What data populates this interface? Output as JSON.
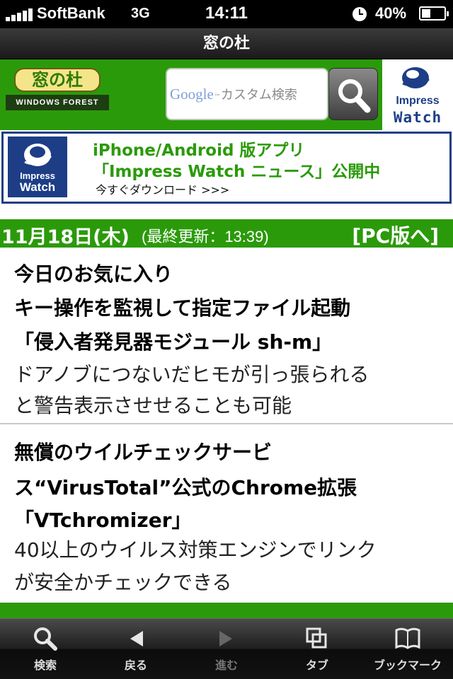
{
  "status_bar": {
    "carrier": "SoftBank",
    "network": "3G",
    "time": "14:11",
    "battery_percent": "40%",
    "battery_level": 0.4
  },
  "title_bar": {
    "title": "窓の杜"
  },
  "header": {
    "logo": {
      "name": "窓の杜",
      "subtitle": "WINDOWS FOREST"
    },
    "search": {
      "google_label": "Google",
      "placeholder": "カスタム検索",
      "button_icon": "search-icon"
    },
    "impress_watch": {
      "line1": "Impress",
      "line2": "Watch"
    }
  },
  "banner": {
    "logo_line1": "Impress",
    "logo_line2": "Watch",
    "line1": "iPhone/Android 版アプリ",
    "line2": "「Impress Watch ニュース」公開中",
    "line3": "今すぐダウンロード >>>"
  },
  "date_bar": {
    "date": "11月18日(木)",
    "updated": "(最終更新：13:39)",
    "pc_link": "[PC版へ]"
  },
  "articles": [
    {
      "title_lines": [
        "今日のお気に入り",
        "キー操作を監視して指定ファイル起動",
        "「侵入者発見器モジュール sh-m」"
      ],
      "desc_lines": [
        "ドアノブにつないだヒモが引っ張られる",
        "と警告表示させせることも可能"
      ]
    },
    {
      "title_lines": [
        "無償のウイルチェックサービ",
        "ス“VirusTotal”公式のChrome拡張",
        "「VTchromizer」"
      ],
      "desc_lines": [
        "40以上のウイルス対策エンジンでリンク",
        "が安全かチェックできる"
      ]
    }
  ],
  "toolbar": {
    "items": [
      {
        "label": "検索",
        "icon": "search-icon"
      },
      {
        "label": "戻る",
        "icon": "back-arrow-icon"
      },
      {
        "label": "進む",
        "icon": "forward-arrow-icon"
      },
      {
        "label": "タブ",
        "icon": "tabs-icon"
      },
      {
        "label": "ブックマーク",
        "icon": "bookmark-book-icon"
      }
    ]
  },
  "colors": {
    "brand_green": "#2b9a0a",
    "impress_blue": "#1d3e86"
  }
}
